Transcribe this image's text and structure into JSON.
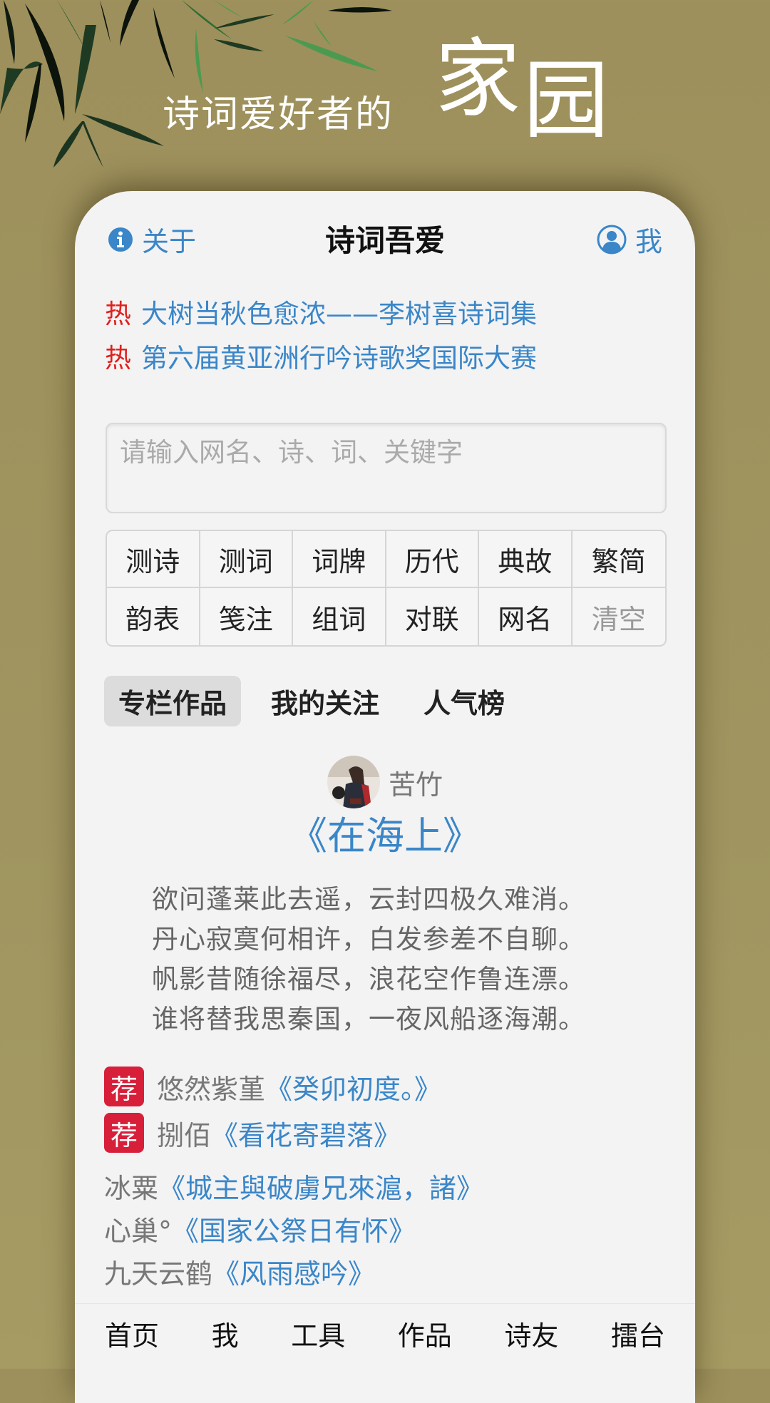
{
  "banner": {
    "tagline": "诗词爱好者的",
    "tagline_big_1": "家",
    "tagline_big_2": "园"
  },
  "header": {
    "about_label": "关于",
    "about_icon": "info-icon",
    "title": "诗词吾爱",
    "me_label": "我",
    "me_icon": "user-circle-icon"
  },
  "hot_links": [
    {
      "tag": "热",
      "text": "大树当秋色愈浓——李树喜诗词集"
    },
    {
      "tag": "热",
      "text": "第六届黄亚洲行吟诗歌奖国际大赛"
    }
  ],
  "search": {
    "placeholder": "请输入网名、诗、词、关键字",
    "value": ""
  },
  "tools": [
    {
      "label": "测诗"
    },
    {
      "label": "测词"
    },
    {
      "label": "词牌"
    },
    {
      "label": "历代"
    },
    {
      "label": "典故"
    },
    {
      "label": "繁简"
    },
    {
      "label": "韵表"
    },
    {
      "label": "笺注"
    },
    {
      "label": "组词"
    },
    {
      "label": "对联"
    },
    {
      "label": "网名"
    },
    {
      "label": "清空"
    }
  ],
  "tabs": [
    {
      "label": "专栏作品",
      "active": true
    },
    {
      "label": "我的关注",
      "active": false
    },
    {
      "label": "人气榜",
      "active": false
    }
  ],
  "featured": {
    "author": "苦竹",
    "title": "《在海上》",
    "lines": [
      "欲问蓬莱此去遥，云封四极久难消。",
      "丹心寂寞何相许，白发参差不自聊。",
      "帆影昔随徐福尽，浪花空作鲁连漂。",
      "谁将替我思秦国，一夜风船逐海潮。"
    ]
  },
  "recommended": [
    {
      "badge": "荐",
      "author": "悠然紫堇",
      "work": "《癸卯初度。》"
    },
    {
      "badge": "荐",
      "author": "捌佰",
      "work": "《看花寄碧落》"
    }
  ],
  "works": [
    {
      "author": "冰粟",
      "work": "《城主與破虜兄來滬，諸》"
    },
    {
      "author": "心巢°",
      "work": "《国家公祭日有怀》"
    },
    {
      "author": "九天云鹤",
      "work": "《风雨感吟》"
    }
  ],
  "bottom_nav": [
    {
      "label": "首页"
    },
    {
      "label": "我"
    },
    {
      "label": "工具"
    },
    {
      "label": "作品"
    },
    {
      "label": "诗友"
    },
    {
      "label": "擂台"
    }
  ],
  "colors": {
    "accent_blue": "#3a86c8",
    "hot_red": "#e0201c",
    "badge_red": "#d81f3a",
    "background": "#9d905c"
  }
}
